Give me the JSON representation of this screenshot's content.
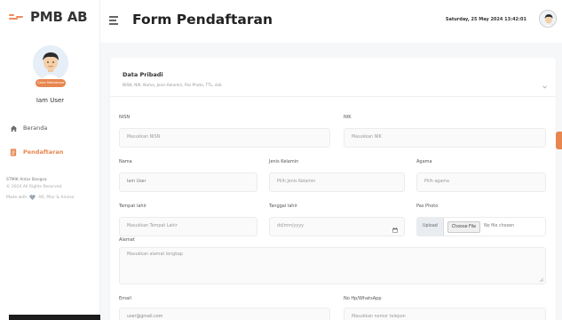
{
  "app": {
    "brand": "PMB AB"
  },
  "sidebar": {
    "role_badge": "Calon Mahasiswa",
    "username": "Iam User",
    "items": [
      {
        "label": "Beranda",
        "icon": "home-icon",
        "active": false
      },
      {
        "label": "Pendaftaran",
        "icon": "document-icon",
        "active": true
      }
    ],
    "footer": {
      "org": "STMIK Antar Bangsa",
      "copyright": "© 2024 All Rights Reserved",
      "made_with_prefix": "Made with",
      "made_with_suffix": "AR, Pilar & Annisa"
    }
  },
  "header": {
    "title": "Form Pendaftaran",
    "datetime": "Saturday, 25 May 2024 13:42:01"
  },
  "form": {
    "section": {
      "title": "Data Pribadi",
      "subtitle": "NISN, NIK, Nama, Jenis Kelamin, Pas Photo, TTL, dsb"
    },
    "nisn": {
      "label": "NISN",
      "placeholder": "Masukkan NISN"
    },
    "nik": {
      "label": "NIK",
      "placeholder": "Masukkan NIK"
    },
    "nama": {
      "label": "Nama",
      "value": "Iam User"
    },
    "jenis_kelamin": {
      "label": "Jenis Kelamin",
      "selected": "Pilih Jenis Kelamin"
    },
    "agama": {
      "label": "Agama",
      "selected": "Pilih agama"
    },
    "tempat_lahir": {
      "label": "Tempat lahir",
      "placeholder": "Masukkan Tempat Lahir"
    },
    "tanggal_lahir": {
      "label": "Tanggal lahir",
      "placeholder": "dd/mm/yyyy"
    },
    "pas_photo": {
      "label": "Pas Photo",
      "upload": "Upload",
      "choose": "Choose File",
      "none": "No file chosen"
    },
    "alamat": {
      "label": "Alamat",
      "placeholder": "Masukkan alamat lengkap"
    },
    "email": {
      "label": "Email",
      "value": "user@gmail.com"
    },
    "no_hp": {
      "label": "No Hp/WhatsApp",
      "placeholder": "Masukkan nomor telepon"
    }
  },
  "colors": {
    "accent": "#e8864f",
    "background": "#f6f7f9"
  }
}
